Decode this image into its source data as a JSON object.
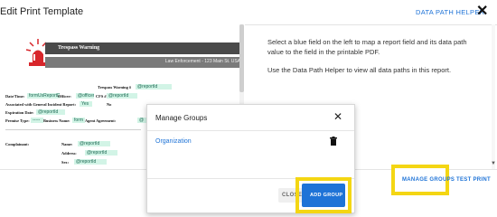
{
  "header": {
    "title": "Edit Print Template",
    "data_path_helper": "DATA PATH HELPER",
    "close_glyph": "✕"
  },
  "preview": {
    "banner_title": "Trespass Warning",
    "agency_line": "Law Enforcement - 123 Main St. USA",
    "rows": [
      {
        "label": "Trespass Warning #",
        "field": "@reportId"
      },
      {
        "label": "Date/Time:",
        "field": "formUsReportDa"
      },
      {
        "label": "Officer:",
        "field": "@officerFi"
      },
      {
        "label": "CFS #",
        "field": "@reportId"
      },
      {
        "label": "Associated with General Incident Report:",
        "field": "Yes"
      },
      {
        "label": "No",
        "field": ""
      },
      {
        "label": "Expiration Date:",
        "field": "@reportId"
      },
      {
        "label": "Premise Type:",
        "field": "-----"
      },
      {
        "label": "Business Name:",
        "field": "form"
      },
      {
        "label": "Agent Agreement:",
        "field": "@"
      },
      {
        "label": "Complainant:",
        "field": ""
      },
      {
        "label": "Name:",
        "field": "@reportId"
      },
      {
        "label": "Address:",
        "field": "@reportId"
      },
      {
        "label": "Sex:",
        "field": "@reportId"
      }
    ]
  },
  "instructions": {
    "p1": "Select a blue field on the left to map a report field and its data path value to the field in the printable PDF.",
    "p2": "Use the Data Path Helper to view all data paths in this report."
  },
  "footer": {
    "manage_groups": "MANAGE GROUPS",
    "test_print": "TEST PRINT"
  },
  "modal": {
    "title": "Manage Groups",
    "close_glyph": "✕",
    "items": [
      "Organization"
    ],
    "cancel_label": "CLOSE",
    "add_group_label": "ADD GROUP"
  },
  "colors": {
    "accent": "#1e73d7",
    "highlight": "#f4d613",
    "field_fill": "#d2f4e6"
  }
}
